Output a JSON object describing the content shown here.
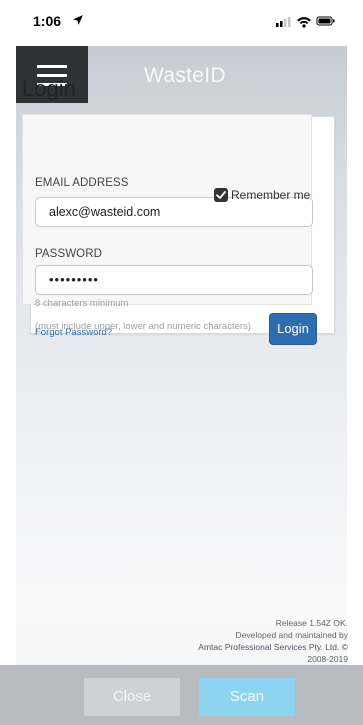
{
  "status_bar": {
    "time": "1:06"
  },
  "header": {
    "app_title": "WasteID"
  },
  "login": {
    "title": "Login",
    "email_label": "EMAIL ADDRESS",
    "email_value": "alexc@wasteid.com",
    "remember_label": "Remember me",
    "remember_checked": true,
    "password_label": "PASSWORD",
    "password_value": "•••••••••",
    "hint_min": "8 characters minimum",
    "hint_rules": "(must include upper, lower and numeric characters)",
    "forgot_label": "Forgot Password?",
    "login_label": "Login"
  },
  "footer": {
    "release": "Release 1.54Z OK.",
    "developed": "Developed and maintained by",
    "company": "Amtac Professional Services Pty. Ltd. ©",
    "years": "2008-2019"
  },
  "bottom_bar": {
    "close_label": "Close",
    "scan_label": "Scan"
  },
  "colors": {
    "accent": "#2d6db0",
    "scan": "#8dd4f1",
    "menu_bg": "#2f3336"
  }
}
